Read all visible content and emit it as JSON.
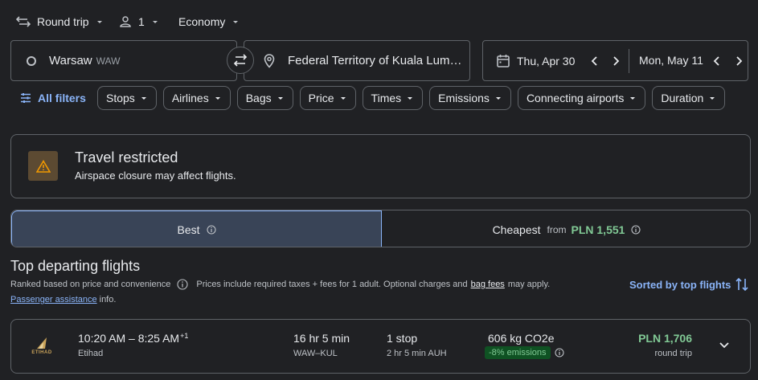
{
  "top_options": {
    "trip_type": "Round trip",
    "passengers": "1",
    "cabin": "Economy"
  },
  "search": {
    "origin_city": "Warsaw",
    "origin_code": "WAW",
    "destination": "Federal Territory of Kuala Lum…",
    "depart_date": "Thu, Apr 30",
    "return_date": "Mon, May 11"
  },
  "filters": {
    "all_filters": "All filters",
    "chips": [
      "Stops",
      "Airlines",
      "Bags",
      "Price",
      "Times",
      "Emissions",
      "Connecting airports",
      "Duration"
    ]
  },
  "notice": {
    "title": "Travel restricted",
    "text": "Airspace closure may affect flights."
  },
  "tabs": {
    "best": "Best",
    "cheapest": "Cheapest",
    "from": "from",
    "cheapest_price": "PLN 1,551"
  },
  "results": {
    "heading": "Top departing flights",
    "ranked": "Ranked based on price and convenience",
    "prices_info": "Prices include required taxes + fees for 1 adult. Optional charges and",
    "bag_fees": "bag fees",
    "may_apply": "may apply.",
    "passenger_assistance": "Passenger assistance",
    "info": "info.",
    "sorted": "Sorted by top flights"
  },
  "flight": {
    "times": "10:20 AM – 8:25 AM",
    "plus_day": "+1",
    "airline": "Etihad",
    "logo_text": "ETIHAD",
    "duration": "16 hr 5 min",
    "route": "WAW–KUL",
    "stops": "1 stop",
    "layover": "2 hr 5 min AUH",
    "co2": "606 kg CO2e",
    "emissions_badge": "-8% emissions",
    "price": "PLN 1,706",
    "price_note": "round trip"
  },
  "colors": {
    "background": "#202124",
    "accent_blue": "#8ab4f8",
    "price_green": "#81c995",
    "warning_orange": "#e37400"
  }
}
